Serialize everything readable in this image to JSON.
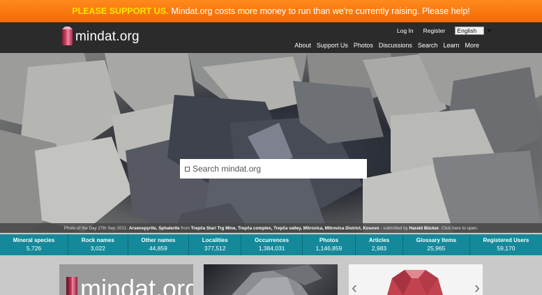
{
  "banner": {
    "strong": "PLEASE SUPPORT US.",
    "text": "Mindat.org costs more money to run than we're currently raising. Please help!"
  },
  "header": {
    "logo_text": "mindat.org",
    "top_links": [
      "Log In",
      "Register"
    ],
    "language": "English",
    "nav": [
      "About",
      "Support Us",
      "Photos",
      "Discussions",
      "Search",
      "Learn",
      "More"
    ]
  },
  "search": {
    "placeholder": "Search mindat.org"
  },
  "caption": {
    "prefix": "Photo of the Day 27th Sep 2021:",
    "minerals": "Arsenopyrite, Sphalerite",
    "from": "from",
    "locality": "Trepča Stari Trg Mine, Trepča complex, Trepča valley, Mitrovica, Mitrovica District, Kosovo",
    "submitted": "- submitted by",
    "author": "Harald Bücker",
    "suffix": ". Click here to open."
  },
  "stats": [
    {
      "label": "Mineral species",
      "value": "5,726"
    },
    {
      "label": "Rock names",
      "value": "3,022"
    },
    {
      "label": "Other names",
      "value": "44,859"
    },
    {
      "label": "Localities",
      "value": "377,512"
    },
    {
      "label": "Occurrences",
      "value": "1,384,031"
    },
    {
      "label": "Photos",
      "value": "1,146,859"
    },
    {
      "label": "Articles",
      "value": "2,983"
    },
    {
      "label": "Glossary Items",
      "value": "25,965"
    },
    {
      "label": "Registered Users",
      "value": "59,170"
    }
  ],
  "cards": {
    "logo_text": "mindat.org"
  },
  "icons": {
    "search": "search-icon",
    "logo": "gem-icon",
    "dropdown": "chevron-down-icon",
    "arrow_left": "chevron-left-icon",
    "arrow_right": "chevron-right-icon"
  }
}
